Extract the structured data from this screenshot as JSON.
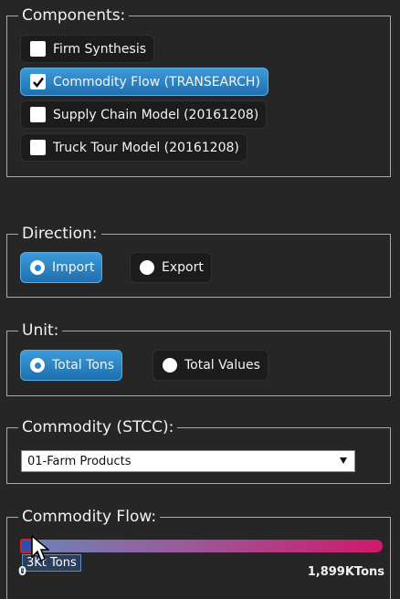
{
  "components": {
    "title": "Components:",
    "items": [
      {
        "label": "Firm Synthesis",
        "checked": false
      },
      {
        "label": "Commodity Flow (TRANSEARCH)",
        "checked": true
      },
      {
        "label": "Supply Chain Model (20161208)",
        "checked": false
      },
      {
        "label": "Truck Tour Model (20161208)",
        "checked": false
      }
    ]
  },
  "direction": {
    "title": "Direction:",
    "options": [
      {
        "label": "Import",
        "selected": true
      },
      {
        "label": "Export",
        "selected": false
      }
    ]
  },
  "unit": {
    "title": "Unit:",
    "options": [
      {
        "label": "Total Tons",
        "selected": true
      },
      {
        "label": "Total Values",
        "selected": false
      }
    ]
  },
  "commodity": {
    "title": "Commodity (STCC):",
    "selected": "01-Farm Products"
  },
  "flow": {
    "title": "Commodity Flow:",
    "tooltip": "3Kt Tons",
    "min_label": "0",
    "max_label": "1,899KTons"
  },
  "colors": {
    "accent": "#2a86cc",
    "background": "#262626",
    "slider_start": "#6a86b8",
    "slider_end": "#d0186a"
  }
}
